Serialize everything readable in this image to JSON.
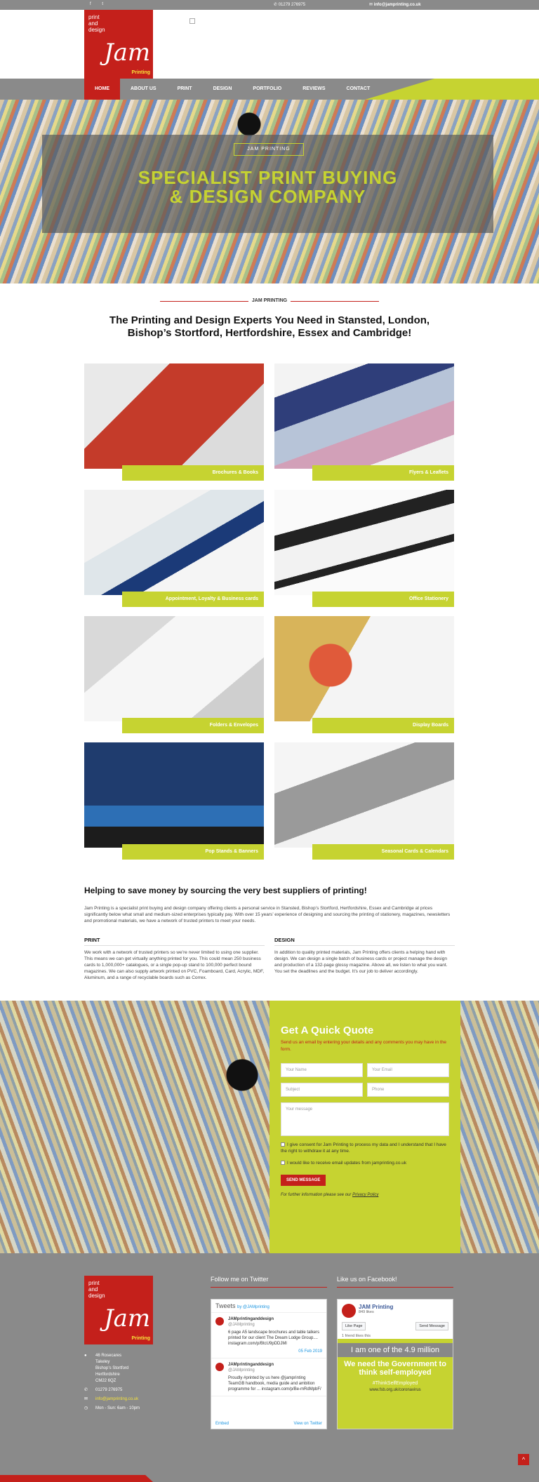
{
  "topbar": {
    "facebook_icon": "f",
    "twitter_icon": "t",
    "phone": "01279 276975",
    "email": "info@jamprinting.co.uk"
  },
  "logo": {
    "line1": "print",
    "line2": "and",
    "line3": "design",
    "script": "Jam",
    "tag": "Printing"
  },
  "nav": {
    "items": [
      "HOME",
      "ABOUT US",
      "PRINT",
      "DESIGN",
      "PORTFOLIO",
      "REVIEWS",
      "CONTACT"
    ]
  },
  "hero": {
    "pill": "JAM PRINTING",
    "title_line1": "SPECIALIST PRINT BUYING",
    "title_line2": "& DESIGN COMPANY"
  },
  "intro": {
    "tag": "JAM PRINTING",
    "heading": "The Printing and Design Experts You Need in Stansted, London, Bishop’s Stortford, Hertfordshire, Essex and Cambridge!"
  },
  "services": [
    "Brochures & Books",
    "Flyers & Leaflets",
    "Appointment, Loyalty & Business cards",
    "Office Stationery",
    "Folders & Envelopes",
    "Display Boards",
    "Pop Stands & Banners",
    "Seasonal Cards & Calendars"
  ],
  "about": {
    "heading": "Helping to save money by sourcing the very best suppliers of printing!",
    "body": "Jam Printing is a specialist print buying and design company offering clients a personal service in Stansted, Bishop’s Stortford, Hertfordshire, Essex and Cambridge at prices significantly below what small and medium-sized enterprises typically pay. With over 15 years’ experience of designing and sourcing the printing of stationery, magazines, newsletters and promotional materials, we have a network of trusted printers to meet your needs.",
    "print_title": "PRINT",
    "print_body": "We work with a network of trusted printers so we’re never limited to using one supplier. This means we can get virtually anything printed for you. This could mean 250 business cards to 1,000,000+ catalogues, or a single pop-up stand to 100,000 perfect bound magazines. We can also supply artwork printed on PVC, Foamboard, Card, Acrylic, MDF, Aluminum, and a range of recyclable boards such as Correx.",
    "design_title": "DESIGN",
    "design_body": "In addition to quality printed materials, Jam Printing offers clients a helping hand with design. We can design a single batch of business cards or project manage the design and production of a 132-page glossy magazine. Above all, we listen to what you want. You set the deadlines and the budget. It’s our job to deliver accordingly."
  },
  "quote": {
    "title": "Get A Quick Quote",
    "subtitle": "Send us an email by entering your details and any comments you may have in the form.",
    "name_placeholder": "Your Name",
    "email_placeholder": "Your Email",
    "subject_placeholder": "Subject",
    "phone_placeholder": "Phone",
    "message_placeholder": "Your message",
    "consent1": "I give consent for Jam Printing to process my data and I understand that I have the right to withdraw it at any time.",
    "consent2": "I would like to receive email updates from jamprinting.co.uk",
    "send": "SEND MESSAGE",
    "note_prefix": "For further information please see our",
    "note_link": "Privacy Policy"
  },
  "footer": {
    "address": [
      "46 Rosecares",
      "Takeley",
      "Bishop’s Stortford",
      "Hertfordshire",
      "CM22 6QZ"
    ],
    "phone": "01279 276975",
    "email": "info@jamprinting.co.uk",
    "hours": "Mon - Sun: 6am - 10pm",
    "twitter_title": "Follow me on Twitter",
    "facebook_title": "Like us on Facebook!",
    "tweets_header": "Tweets",
    "tweets_by": "by @JAMprinting",
    "tweets": [
      {
        "name": "JAMprintinganddesign",
        "handle": "@JAMprinting",
        "text": "6 page A5 landscape brochures and table talkers printed for our client The Dream Lodge Group.... instagram.com/p/BtcU9pDDJMl",
        "date": "05 Feb 2019"
      },
      {
        "name": "JAMprintinganddesign",
        "handle": "@JAMprinting",
        "text": "Proudly #printed by us here @jamprinting TeamGB handbook, media guide and ambition programme for ... instagram.com/p/Be-mRdMpbF/"
      }
    ],
    "embed": "Embed",
    "view_on_twitter": "View on Twitter",
    "fb_name": "JAM Printing",
    "fb_likes": "849 likes",
    "fb_like_btn": "Like Page",
    "fb_send_btn": "Send Message",
    "fb_friend": "1 friend likes this",
    "fb_post_gray": "I am one of the 4.9 million",
    "fb_post_big": "We need the Government to think self-employed",
    "fb_post_hash": "#ThinkSelfEmployed",
    "fb_post_url": "www.fsb.org.uk/coronavirus",
    "totop": "^"
  },
  "colors": {
    "brand_red": "#c4201b",
    "lime": "#c6d331",
    "gray": "#8a8a8a",
    "yellow": "#f6e33b"
  }
}
